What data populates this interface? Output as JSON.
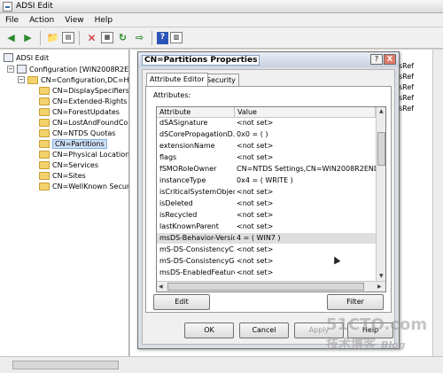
{
  "app": {
    "title": "ADSI Edit"
  },
  "menu": [
    "File",
    "Action",
    "View",
    "Help"
  ],
  "tree": {
    "root": "ADSI Edit",
    "config": "Configuration [WIN2008R2END",
    "configdc": "CN=Configuration,DC=HBY",
    "children": [
      "CN=DisplaySpecifiers",
      "CN=Extended-Rights",
      "CN=ForestUpdates",
      "CN=LostAndFoundCon",
      "CN=NTDS Quotas",
      "CN=Partitions",
      "CN=Physical Locations",
      "CN=Services",
      "CN=Sites",
      "CN=WellKnown Securit"
    ]
  },
  "right_pane": {
    "items": [
      "sRef",
      "sRef",
      "sRef",
      "sRef",
      "sRef"
    ]
  },
  "dialog": {
    "title": "CN=Partitions Properties",
    "help_label": "?",
    "close_label": "X",
    "tabs": [
      "Attribute Editor",
      "Security"
    ],
    "attributes_label": "Attributes:",
    "columns": [
      "Attribute",
      "Value"
    ],
    "rows": [
      {
        "attr": "dSASignature",
        "value": "<not set>"
      },
      {
        "attr": "dSCorePropagationD...",
        "value": "0x0 = ( )"
      },
      {
        "attr": "extensionName",
        "value": "<not set>"
      },
      {
        "attr": "flags",
        "value": "<not set>"
      },
      {
        "attr": "fSMORoleOwner",
        "value": "CN=NTDS Settings,CN=WIN2008R2ENDC,C"
      },
      {
        "attr": "instanceType",
        "value": "0x4 = ( WRITE )"
      },
      {
        "attr": "isCriticalSystemObject",
        "value": "<not set>"
      },
      {
        "attr": "isDeleted",
        "value": "<not set>"
      },
      {
        "attr": "isRecycled",
        "value": "<not set>"
      },
      {
        "attr": "lastKnownParent",
        "value": "<not set>"
      },
      {
        "attr": "msDS-Behavior-Version",
        "value": "4 = ( WIN7 )"
      },
      {
        "attr": "mS-DS-ConsistencyC...",
        "value": "<not set>"
      },
      {
        "attr": "mS-DS-ConsistencyG...",
        "value": "<not set>"
      },
      {
        "attr": "msDS-EnabledFeature",
        "value": "<not set>"
      }
    ],
    "edit_label": "Edit",
    "filter_label": "Filter",
    "ok_label": "OK",
    "cancel_label": "Cancel",
    "apply_label": "Apply",
    "helpbtn_label": "Help"
  },
  "watermark": {
    "top": "51CTO.com",
    "bottom": "技术博客",
    "blog": "Blog"
  }
}
